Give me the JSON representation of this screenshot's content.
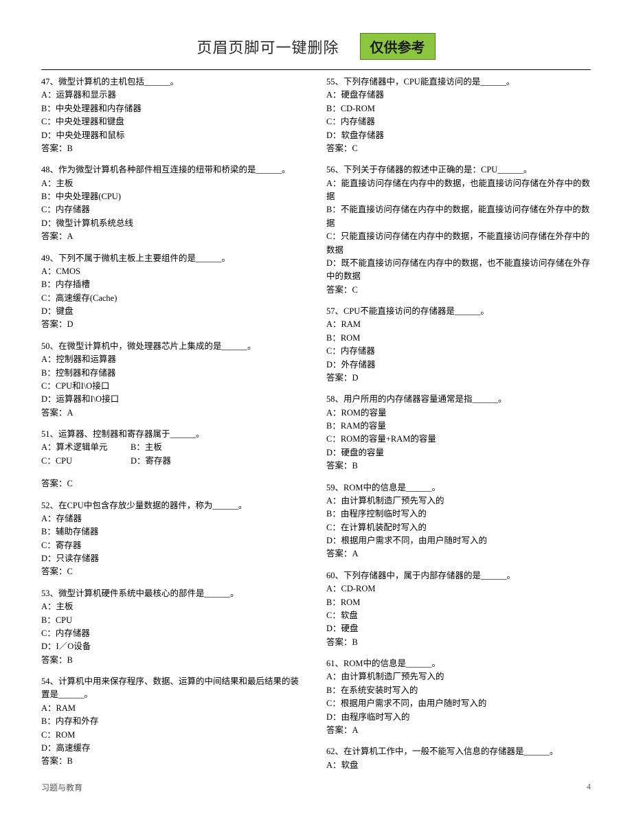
{
  "header": {
    "title": "页眉页脚可一键删除",
    "badge": "仅供参考"
  },
  "left": [
    {
      "stem": "47、微型计算机的主机包括______。",
      "opts": [
        "A：运算器和显示器",
        "B：中央处理器和内存储器",
        "C：中央处理器和键盘",
        "D：中央处理器和鼠标"
      ],
      "ans": "答案：B"
    },
    {
      "stem": "48、作为微型计算机各种部件相互连接的纽带和桥梁的是______。",
      "opts": [
        "A：主板",
        "B：中央处理器(CPU)",
        "C：内存储器",
        "D：微型计算机系统总线"
      ],
      "ans": "答案：A"
    },
    {
      "stem": "49、下列不属于微机主板上主要组件的是______。",
      "opts": [
        "A：CMOS",
        "B：内存插槽",
        "C：高速缓存(Cache)",
        "D：键盘"
      ],
      "ans": "答案：D"
    },
    {
      "stem": "50、在微型计算机中，微处理器芯片上集成的是______。",
      "opts": [
        "A：控制器和运算器",
        "B：控制器和存储器",
        "C：CPU和I\\O接口",
        "D：运算器和I\\O接口"
      ],
      "ans": "答案：A"
    },
    {
      "stem": "51、运算器、控制器和寄存器属于______。",
      "opts_inline": [
        [
          "A：算术逻辑单元",
          "B：主板"
        ],
        [
          "C：CPU",
          "D：寄存器"
        ]
      ],
      "ans": "答案：C",
      "ans_spaced": true
    },
    {
      "stem": "52、在CPU中包含存放少量数据的器件，称为______。",
      "opts": [
        "A：存储器",
        "B：辅助存储器",
        "C：寄存器",
        "D：只读存储器"
      ],
      "ans": "答案：C"
    },
    {
      "stem": "53、微型计算机硬件系统中最核心的部件是______。",
      "opts": [
        "A：主板",
        "B：CPU",
        "C：内存储器",
        "D：I／O设备"
      ],
      "ans": "答案：B"
    },
    {
      "stem": "54、计算机中用来保存程序、数据、运算的中间结果和最后结果的装置是______。",
      "opts": [
        "A：RAM",
        "B：内存和外存",
        "C：ROM",
        "D：高速缓存"
      ],
      "ans": "答案：B"
    }
  ],
  "right": [
    {
      "stem": "55、下列存储器中，CPU能直接访问的是______。",
      "opts": [
        "A：硬盘存储器",
        "B：CD-ROM",
        "C：内存储器",
        "D：软盘存储器"
      ],
      "ans": "答案：C"
    },
    {
      "stem": "56、下列关于存储器的叙述中正确的是：CPU______。",
      "opts": [
        "A：能直接访问存储在内存中的数据，也能直接访问存储在外存中的数据",
        "B：不能直接访问存储在内存中的数据，能直接访问存储在外存中的数据",
        "C：只能直接访问存储在内存中的数据，不能直接访问存储在外存中的数据",
        "D：既不能直接访问存储在内存中的数据，也不能直接访问存储在外存中的数据"
      ],
      "ans": "答案：C"
    },
    {
      "stem": "57、CPU不能直接访问的存储器是______。",
      "opts": [
        "A：RAM",
        "B：ROM",
        "C：内存储器",
        "D：外存储器"
      ],
      "ans": "答案：D"
    },
    {
      "stem": "58、用户所用的内存储器容量通常是指______。",
      "opts": [
        "A：ROM的容量",
        "B：RAM的容量",
        "C：ROM的容量+RAM的容量",
        "D：硬盘的容量"
      ],
      "ans": "答案：B"
    },
    {
      "stem": "59、ROM中的信息是______。",
      "opts": [
        "A：由计算机制造厂预先写入的",
        "B：由程序控制临时写入的",
        "C：在计算机装配时写入的",
        "D：根据用户需求不同，由用户随时写入的"
      ],
      "ans": "答案：A"
    },
    {
      "stem": "60、下列存储器中，属于内部存储器的是______。",
      "opts": [
        "A：CD-ROM",
        "B：ROM",
        "C：软盘",
        "D：硬盘"
      ],
      "ans": "答案：B"
    },
    {
      "stem": "61、ROM中的信息是______。",
      "opts": [
        "A：由计算机制造厂预先写入的",
        "B：在系统安装时写入的",
        "C：根据用户需求不同，由用户随时写入的",
        "D：由程序临时写入的"
      ],
      "ans": "答案：A"
    },
    {
      "stem": "62、在计算机工作中，一般不能写入信息的存储器是______。",
      "opts": [
        "A：软盘"
      ]
    }
  ],
  "footer": {
    "left": "习题与教育",
    "page": "4"
  }
}
